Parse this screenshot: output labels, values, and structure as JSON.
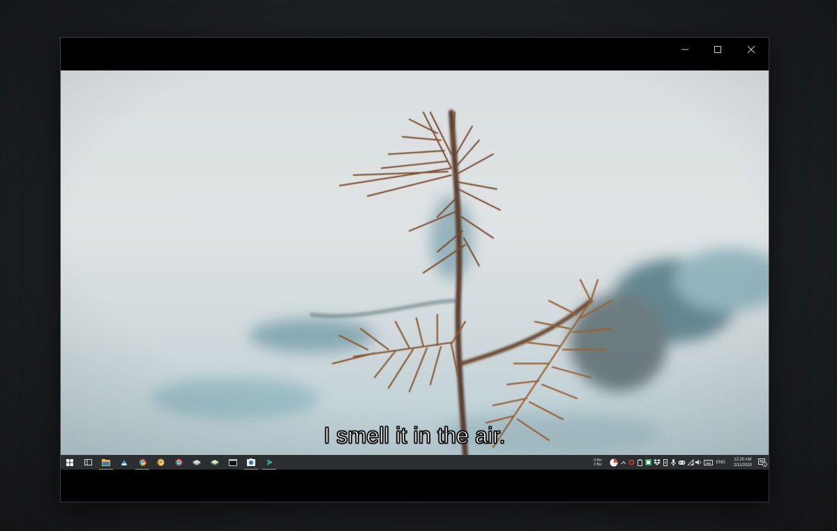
{
  "window": {
    "controls": {
      "minimize": "minimize",
      "maximize": "maximize",
      "close": "close"
    }
  },
  "video": {
    "subtitle": "I smell it in the air."
  },
  "taskbar": {
    "pinned_icons": [
      "windows-start-icon",
      "task-view-icon",
      "file-explorer-icon",
      "app-blue-icon",
      "chrome-icon",
      "chrome-canary-icon",
      "chrome-dev-icon",
      "stack-icon",
      "stack-green-icon",
      "terminal-icon",
      "screen-capture-icon",
      "arrow-app-icon"
    ],
    "tray": {
      "net_up": "0 B/s",
      "net_down": "0 B/s",
      "language": "ENG",
      "time": "12:20 AM",
      "date": "2/11/2020",
      "notification_count": "1"
    }
  },
  "colors": {
    "taskbar_bg": "#2b2f31",
    "window_bg": "#000000",
    "subtitle_fill": "#ffffff"
  }
}
